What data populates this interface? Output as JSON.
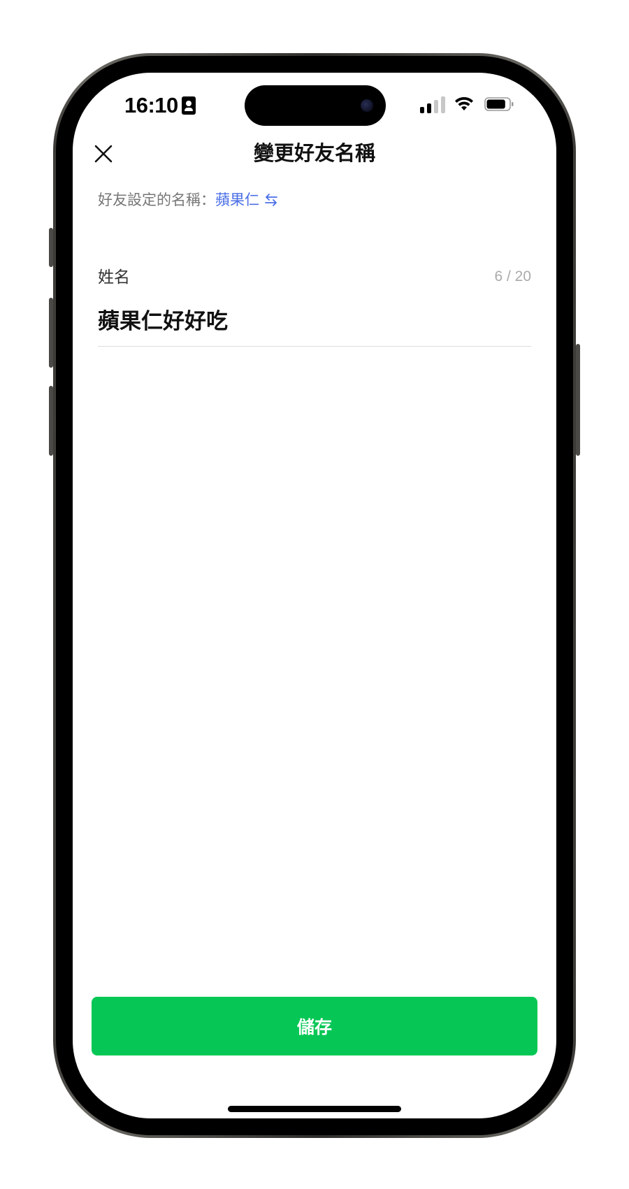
{
  "status_bar": {
    "time": "16:10",
    "signal_bars": 2,
    "signal_bars_total": 4,
    "battery_level": 0.85
  },
  "nav": {
    "title": "變更好友名稱",
    "close_icon": "close-icon"
  },
  "friend_setting": {
    "label": "好友設定的名稱：",
    "name": "蘋果仁",
    "swap_icon": "swap-arrows-icon"
  },
  "name_field": {
    "label": "姓名",
    "counter": "6 / 20",
    "value": "蘋果仁好好吃"
  },
  "footer": {
    "save_label": "儲存"
  },
  "colors": {
    "accent_green": "#06c755",
    "link_blue": "#4b6fe6",
    "counter_gray": "#aaaaaa"
  }
}
